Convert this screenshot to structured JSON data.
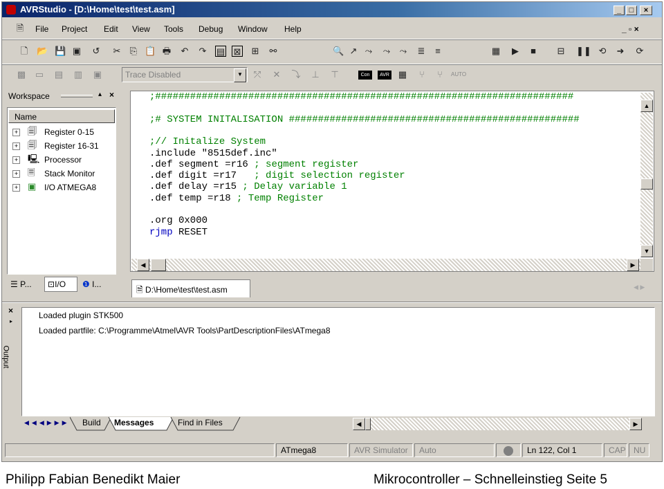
{
  "window": {
    "title": "AVRStudio - [D:\\Home\\test\\test.asm]"
  },
  "menu": [
    "File",
    "Project",
    "Edit",
    "View",
    "Tools",
    "Debug",
    "Window",
    "Help"
  ],
  "toolbar": {
    "trace_dropdown": "Trace Disabled",
    "auto_label": "AUTO",
    "con_label": "Con",
    "avr_label": "AVR"
  },
  "workspace": {
    "title": "Workspace",
    "column_header": "Name",
    "items": [
      {
        "label": "Register 0-15",
        "icon": "register-icon"
      },
      {
        "label": "Register 16-31",
        "icon": "register-icon"
      },
      {
        "label": "Processor",
        "icon": "processor-icon"
      },
      {
        "label": "Stack Monitor",
        "icon": "stack-icon"
      },
      {
        "label": "I/O ATMEGA8",
        "icon": "io-icon"
      }
    ],
    "tabs": [
      "P...",
      "I/O",
      "I..."
    ]
  },
  "editor": {
    "lines": [
      ";########################################################################",
      "",
      ";# SYSTEM INITALISATION ##################################################",
      "",
      ";// Initalize System",
      ".include \"8515def.inc\"",
      ".def segment =r16 ; segment register",
      ".def digit =r17   ; digit selection register",
      ".def delay =r15 ; Delay variable 1",
      ".def temp =r18 ; Temp Register",
      "",
      ".org 0x000",
      "rjmp RESET"
    ],
    "doc_tab": "D:\\Home\\test\\test.asm"
  },
  "output": {
    "label": "Output",
    "lines": [
      "Loaded plugin STK500",
      "Loaded partfile: C:\\Programme\\Atmel\\AVR Tools\\PartDescriptionFiles\\ATmega8"
    ],
    "tabs": [
      "Build",
      "Messages",
      "Find in Files"
    ]
  },
  "status": {
    "device": "ATmega8",
    "simulator": "AVR Simulator",
    "auto": "Auto",
    "position": "Ln 122, Col 1",
    "cap": "CAP",
    "num": "NU"
  },
  "footer": {
    "left": "Philipp Fabian Benedikt Maier",
    "right": "Mikrocontroller – Schnelleinstieg  Seite 5"
  }
}
